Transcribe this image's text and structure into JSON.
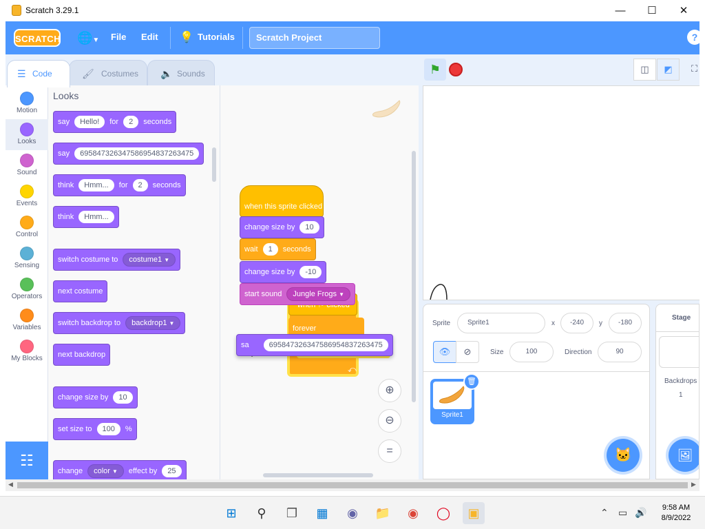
{
  "window": {
    "title": "Scratch 3.29.1"
  },
  "menubar": {
    "logo": "SCRATCH",
    "file": "File",
    "edit": "Edit",
    "tutorials": "Tutorials",
    "project_title": "Scratch Project",
    "help": "?"
  },
  "tabs": [
    {
      "label": "Code"
    },
    {
      "label": "Costumes"
    },
    {
      "label": "Sounds"
    }
  ],
  "categories": [
    {
      "label": "Motion",
      "color": "#4c97ff"
    },
    {
      "label": "Looks",
      "color": "#9966ff"
    },
    {
      "label": "Sound",
      "color": "#cf63cf"
    },
    {
      "label": "Events",
      "color": "#ffd500"
    },
    {
      "label": "Control",
      "color": "#ffab19"
    },
    {
      "label": "Sensing",
      "color": "#5cb1d6"
    },
    {
      "label": "Operators",
      "color": "#59c059"
    },
    {
      "label": "Variables",
      "color": "#ff8c1a"
    },
    {
      "label": "My Blocks",
      "color": "#ff6680"
    }
  ],
  "palette": {
    "title": "Looks",
    "blocks": {
      "say_for": {
        "say": "say",
        "msg": "Hello!",
        "for": "for",
        "secs": "2",
        "seconds": "seconds"
      },
      "say": {
        "say": "say",
        "msg": "695847326347586954837263475"
      },
      "think_for": {
        "think": "think",
        "msg": "Hmm...",
        "for": "for",
        "secs": "2",
        "seconds": "seconds"
      },
      "think": {
        "think": "think",
        "msg": "Hmm..."
      },
      "switch_costume": {
        "label": "switch costume to",
        "value": "costume1"
      },
      "next_costume": {
        "label": "next costume"
      },
      "switch_backdrop": {
        "label": "switch backdrop to",
        "value": "backdrop1"
      },
      "next_backdrop": {
        "label": "next backdrop"
      },
      "change_size": {
        "label": "change size by",
        "value": "10"
      },
      "set_size": {
        "label": "set size to",
        "value": "100",
        "unit": "%"
      },
      "change_effect": {
        "label": "change",
        "effect": "color",
        "by": "effect by",
        "value": "25"
      }
    }
  },
  "script": {
    "hat": "when this sprite clicked",
    "change_size": {
      "label": "change size by",
      "value": "10"
    },
    "wait": {
      "label": "wait",
      "value": "1",
      "unit": "seconds"
    },
    "change_size2": {
      "label": "change size by",
      "value": "-10"
    },
    "start_sound": {
      "label": "start sound",
      "value": "Jungle Frogs"
    },
    "hidden_hat": "when ⚑ clicked",
    "forever": "forever",
    "dragged_say": {
      "label": "sa",
      "value": "695847326347586954837263475"
    }
  },
  "stage_info": {
    "sprite_label": "Sprite",
    "sprite_name": "Sprite1",
    "x_label": "x",
    "x": "-240",
    "y_label": "y",
    "y": "-180",
    "show_label": "Show",
    "size_label": "Size",
    "size": "100",
    "direction_label": "Direction",
    "direction": "90"
  },
  "sprites": [
    {
      "name": "Sprite1"
    }
  ],
  "stage_selector": {
    "title": "Stage",
    "backdrops_label": "Backdrops",
    "backdrops_count": "1"
  },
  "taskbar": {
    "time": "9:58 AM",
    "date": "8/9/2022"
  },
  "colors": {
    "menubar": "#4c97ff",
    "looks": "#9966ff",
    "events": "#ffbf00",
    "control": "#ffab19",
    "sound": "#cf63cf"
  }
}
